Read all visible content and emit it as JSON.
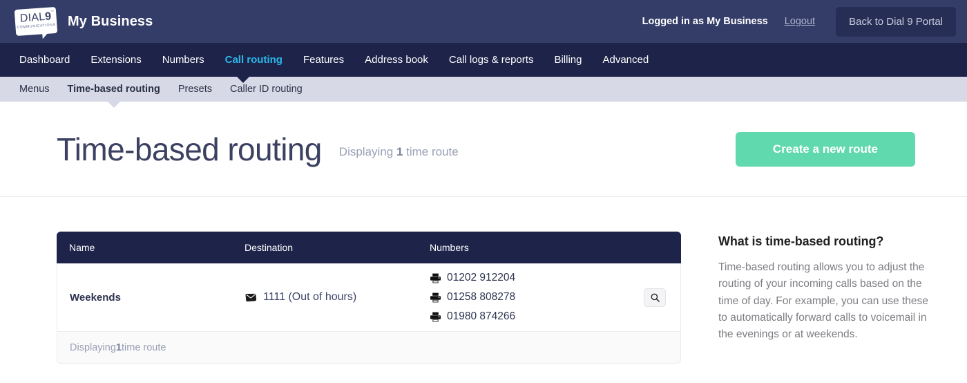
{
  "topbar": {
    "logo": {
      "name": "DIAL9",
      "dial": "DIAL",
      "nine": "9",
      "subtitle": "COMMUNICATIONS",
      "tm": "™"
    },
    "brand_title": "My Business",
    "logged_in": "Logged in as My Business",
    "logout": "Logout",
    "portal_button": "Back to Dial 9 Portal",
    "bg": "#343c68",
    "button_bg": "#272e55"
  },
  "mainnav": {
    "bg": "#1d2349",
    "active_color": "#2bb8ea",
    "items": [
      {
        "label": "Dashboard",
        "active": false
      },
      {
        "label": "Extensions",
        "active": false
      },
      {
        "label": "Numbers",
        "active": false
      },
      {
        "label": "Call routing",
        "active": true
      },
      {
        "label": "Features",
        "active": false
      },
      {
        "label": "Address book",
        "active": false
      },
      {
        "label": "Call logs & reports",
        "active": false
      },
      {
        "label": "Billing",
        "active": false
      },
      {
        "label": "Advanced",
        "active": false
      }
    ]
  },
  "subnav": {
    "bg": "#d7dae6",
    "items": [
      {
        "label": "Menus",
        "active": false
      },
      {
        "label": "Time-based routing",
        "active": true
      },
      {
        "label": "Presets",
        "active": false
      },
      {
        "label": "Caller ID routing",
        "active": false
      }
    ]
  },
  "title_section": {
    "title": "Time-based routing",
    "count_prefix": "Displaying ",
    "count_value": "1",
    "count_suffix": " time route",
    "create_button": "Create a new route",
    "create_button_color": "#5fd9ad"
  },
  "table": {
    "headers": {
      "name": "Name",
      "destination": "Destination",
      "numbers": "Numbers"
    },
    "rows": [
      {
        "name": "Weekends",
        "destination": "1111 (Out of hours)",
        "destination_icon": "voicemail-envelope-icon",
        "numbers": [
          {
            "value": "01202 912204",
            "icon": "desk-phone-icon"
          },
          {
            "value": "01258 808278",
            "icon": "desk-phone-icon"
          },
          {
            "value": "01980 874266",
            "icon": "desk-phone-icon"
          }
        ],
        "action_icon": "search-icon"
      }
    ],
    "footer_prefix": "Displaying ",
    "footer_value": "1",
    "footer_suffix": " time route"
  },
  "aside": {
    "heading": "What is time-based routing?",
    "body": "Time-based routing allows you to adjust the routing of your incoming calls based on the time of day. For example, you can use these to automatically forward calls to voicemail in the evenings or at weekends."
  }
}
